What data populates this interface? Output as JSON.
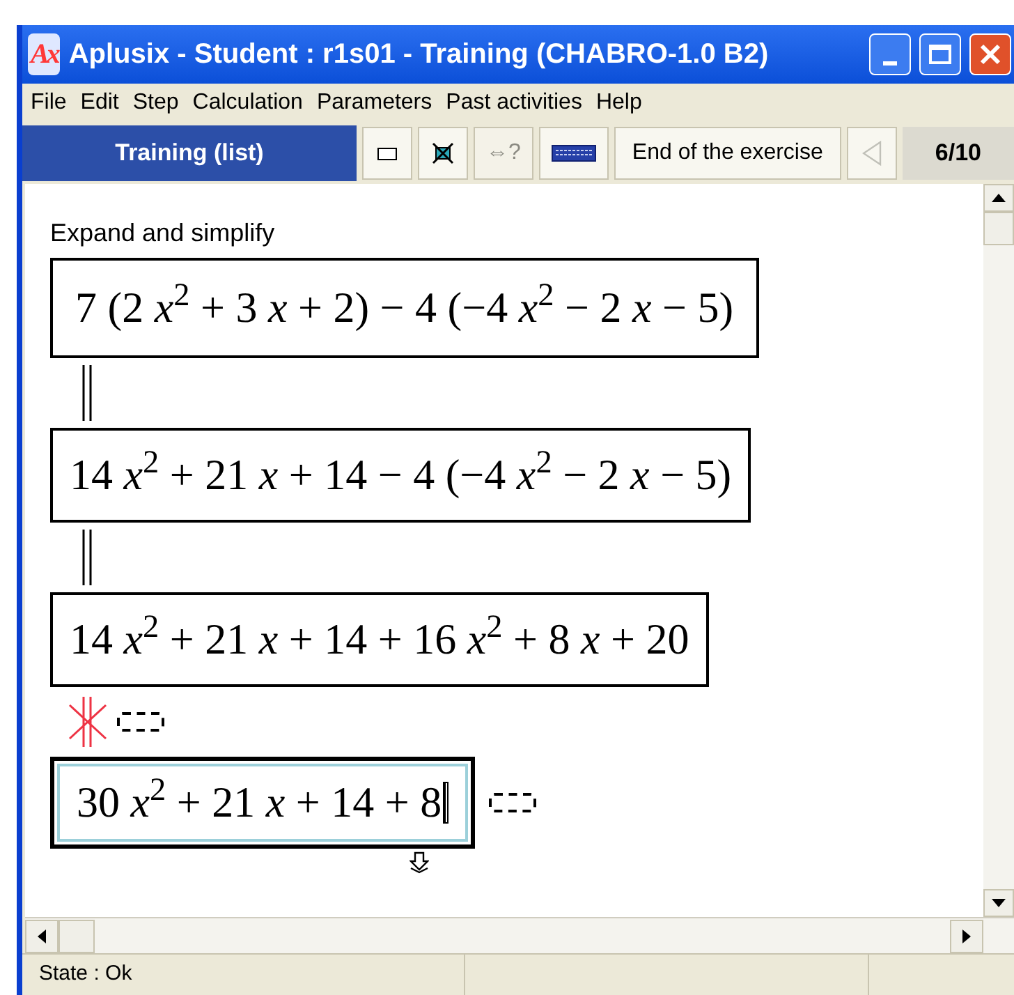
{
  "window": {
    "logo": "Ax",
    "title": "Aplusix - Student : r1s01 - Training (CHABRO-1.0 B2)"
  },
  "menu": [
    "File",
    "Edit",
    "Step",
    "Calculation",
    "Parameters",
    "Past activities",
    "Help"
  ],
  "toolbar": {
    "mode": "Training (list)",
    "buttons": [
      {
        "kind": "box",
        "disabled": false
      },
      {
        "kind": "cross",
        "disabled": false
      },
      {
        "kind": "equiv",
        "label": "⇔?",
        "disabled": true
      },
      {
        "kind": "keyboard",
        "disabled": false
      }
    ],
    "end_button": "End of the exercise",
    "prev_disabled": true,
    "counter": "6/10"
  },
  "exercise": {
    "instruction": "Expand and simplify",
    "steps": [
      {
        "kind": "given",
        "expression": "7 (2 *x*$^{2}$ + 3 *x* + 2) − 4 (−4 *x*$^{2}$ − 2 *x* − 5)",
        "cursor": false
      },
      {
        "kind": "step",
        "equivalent": true,
        "expression": "14 *x*$^{2}$ + 21 *x* + 14 − 4 (−4 *x*$^{2}$ − 2 *x* − 5)",
        "cursor": false
      },
      {
        "kind": "step",
        "equivalent": true,
        "expression": "14 *x*$^{2}$ + 21 *x* + 14 + 16 *x*$^{2}$ + 8 *x* + 20",
        "cursor": false
      },
      {
        "kind": "active",
        "equivalent": false,
        "expression": "30 *x*$^{2}$ + 21 *x* + 14 + 8",
        "cursor": true
      }
    ]
  },
  "status_bar": {
    "state": "State : Ok"
  }
}
